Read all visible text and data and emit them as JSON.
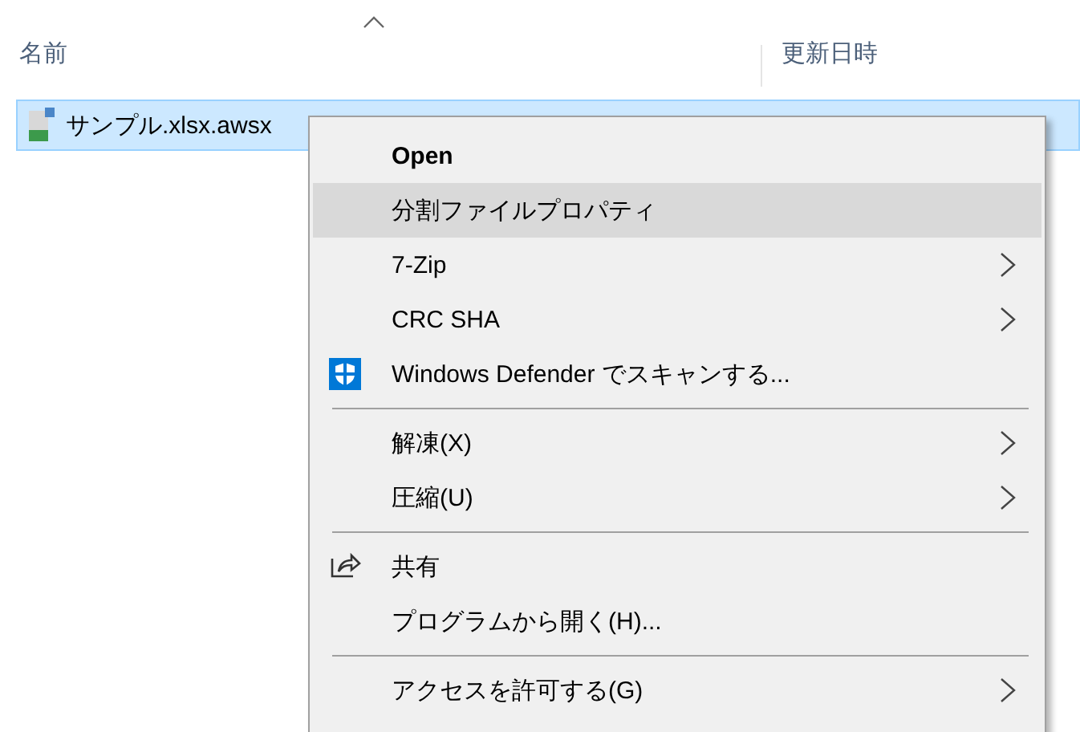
{
  "columns": [
    {
      "label": "名前"
    },
    {
      "label": "更新日時"
    }
  ],
  "files": [
    {
      "name": "サンプル.xlsx.awsx",
      "selected": true
    }
  ],
  "context_menu": [
    {
      "kind": "default",
      "label": "Open",
      "selected": false
    },
    {
      "kind": "plain",
      "label": "分割ファイルプロパティ",
      "selected": true
    },
    {
      "kind": "submenu",
      "label": "7-Zip",
      "selected": false
    },
    {
      "kind": "submenu",
      "label": "CRC SHA",
      "selected": false
    },
    {
      "kind": "defender",
      "label": "Windows Defender でスキャンする...",
      "selected": false
    },
    {
      "kind": "separator"
    },
    {
      "kind": "submenu",
      "label": "解凍(X)",
      "selected": false
    },
    {
      "kind": "submenu",
      "label": "圧縮(U)",
      "selected": false
    },
    {
      "kind": "separator"
    },
    {
      "kind": "share",
      "label": "共有",
      "selected": false
    },
    {
      "kind": "plain",
      "label": "プログラムから開く(H)...",
      "selected": false
    },
    {
      "kind": "separator"
    },
    {
      "kind": "submenu",
      "label": "アクセスを許可する(G)",
      "selected": false
    }
  ]
}
